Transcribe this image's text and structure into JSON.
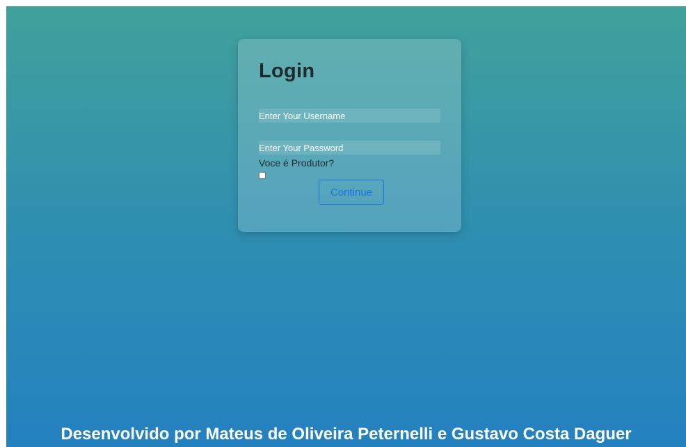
{
  "login": {
    "title": "Login",
    "username_placeholder": "Enter Your Username",
    "password_placeholder": "Enter Your Password",
    "producer_label": "Voce é Produtor?",
    "producer_checked": false,
    "continue_label": "Continue"
  },
  "footer": {
    "credits": "Desenvolvido por Mateus de Oliveira Peternelli e Gustavo Costa Daguer"
  },
  "colors": {
    "background_top": "#41a19b",
    "background_bottom": "#2481c0",
    "button_accent": "#1a73e8",
    "title_text": "#1f2a30"
  }
}
